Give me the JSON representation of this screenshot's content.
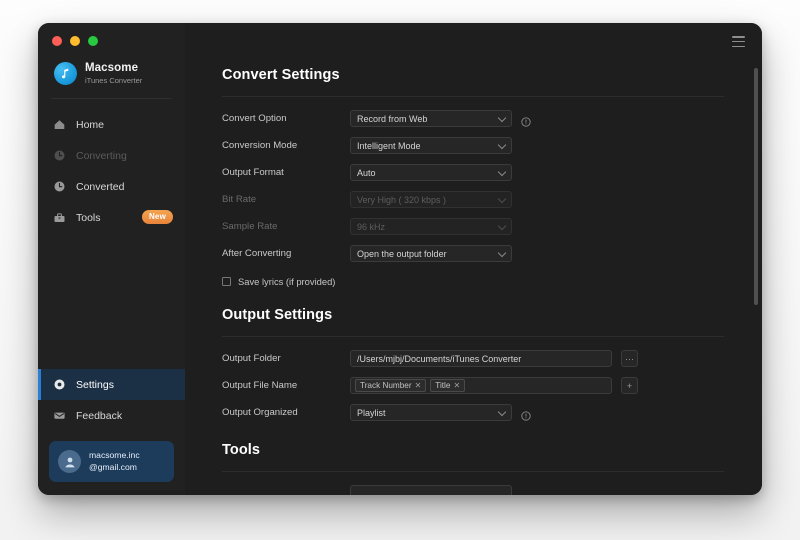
{
  "window": {
    "traffic_lights": [
      "close",
      "minimize",
      "maximize"
    ],
    "menu_icon": "hamburger-icon"
  },
  "brand": {
    "name": "Macsome",
    "subtitle": "iTunes Converter",
    "logo_icon": "music-note-icon"
  },
  "sidebar": {
    "items": [
      {
        "label": "Home",
        "icon": "home-icon",
        "state": "normal"
      },
      {
        "label": "Converting",
        "icon": "clock-icon",
        "state": "disabled"
      },
      {
        "label": "Converted",
        "icon": "clock-icon",
        "state": "normal"
      },
      {
        "label": "Tools",
        "icon": "toolbox-icon",
        "state": "normal",
        "badge": "New"
      }
    ],
    "bottom_items": [
      {
        "label": "Settings",
        "icon": "gear-icon",
        "state": "active"
      },
      {
        "label": "Feedback",
        "icon": "envelope-icon",
        "state": "normal"
      }
    ],
    "account": {
      "icon": "user-avatar-icon",
      "line1": "macsome.inc",
      "line2": "@gmail.com"
    }
  },
  "main": {
    "convert_settings": {
      "title": "Convert Settings",
      "rows": [
        {
          "label": "Convert Option",
          "value": "Record from Web",
          "disabled": false,
          "info": true
        },
        {
          "label": "Conversion Mode",
          "value": "Intelligent Mode",
          "disabled": false,
          "info": false
        },
        {
          "label": "Output Format",
          "value": "Auto",
          "disabled": false,
          "info": false
        },
        {
          "label": "Bit Rate",
          "value": "Very High ( 320 kbps )",
          "disabled": true,
          "info": false
        },
        {
          "label": "Sample Rate",
          "value": "96 kHz",
          "disabled": true,
          "info": false
        },
        {
          "label": "After Converting",
          "value": "Open the output folder",
          "disabled": false,
          "info": false
        }
      ],
      "checkbox": {
        "label": "Save lyrics (if provided)",
        "checked": false
      }
    },
    "output_settings": {
      "title": "Output Settings",
      "output_folder": {
        "label": "Output Folder",
        "value": "/Users/mjbj/Documents/iTunes Converter",
        "button": "···"
      },
      "output_file_name": {
        "label": "Output File Name",
        "tags": [
          "Track Number",
          "Title"
        ],
        "button": "+"
      },
      "output_organized": {
        "label": "Output Organized",
        "value": "Playlist",
        "info": true
      }
    },
    "tools": {
      "title": "Tools"
    }
  },
  "colors": {
    "accent": "#2a7fd4",
    "badge": "#e8843a",
    "window_bg": "#1e1e1e",
    "sidebar_bg": "#212121"
  }
}
